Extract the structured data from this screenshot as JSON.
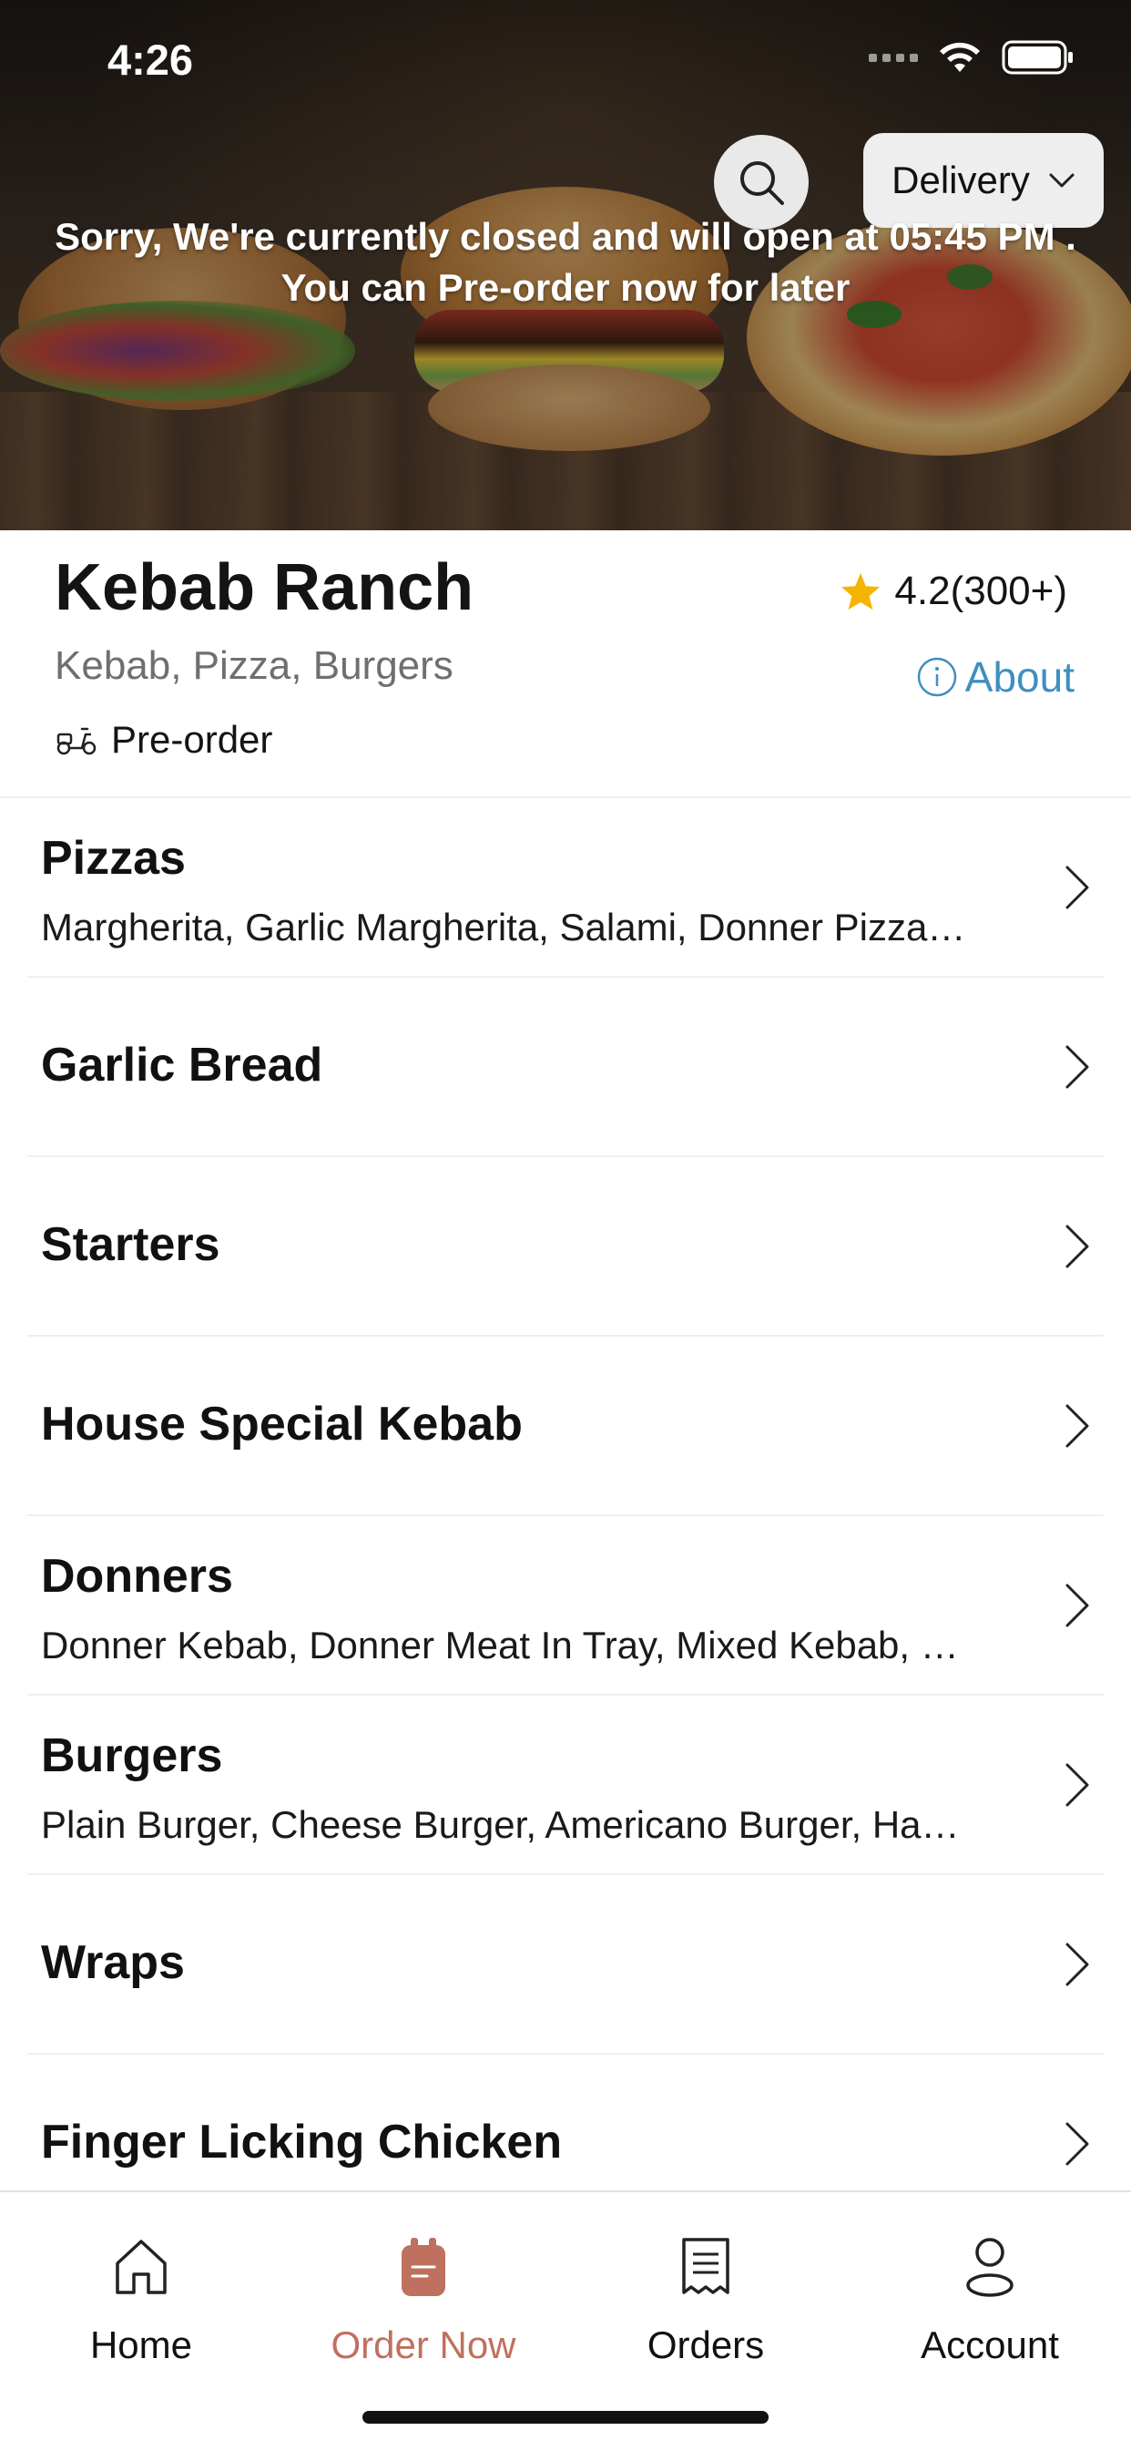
{
  "status_bar": {
    "time": "4:26"
  },
  "header": {
    "delivery_mode": "Delivery",
    "closed_message_line1": "Sorry, We're currently closed and will open at 05:45 PM .",
    "closed_message_line2": "You can Pre-order now for later"
  },
  "restaurant": {
    "name": "Kebab Ranch",
    "cuisines": "Kebab, Pizza, Burgers",
    "order_type": "Pre-order",
    "rating": "4.2(300+)",
    "about_label": "About"
  },
  "categories": [
    {
      "title": "Pizzas",
      "desc": "Margherita, Garlic Margherita, Salami, Donner Pizza,..."
    },
    {
      "title": "Garlic Bread",
      "desc": ""
    },
    {
      "title": "Starters",
      "desc": ""
    },
    {
      "title": "House Special Kebab",
      "desc": ""
    },
    {
      "title": "Donners",
      "desc": "Donner Kebab, Donner Meat In Tray, Mixed Kebab, Mi..."
    },
    {
      "title": "Burgers",
      "desc": "Plain Burger, Cheese Burger, Americano Burger, Hawa..."
    },
    {
      "title": "Wraps",
      "desc": ""
    },
    {
      "title": "Finger Licking Chicken",
      "desc": ""
    }
  ],
  "bottom_nav": {
    "home": "Home",
    "order_now": "Order Now",
    "orders": "Orders",
    "account": "Account",
    "active": "order_now"
  },
  "colors": {
    "accent": "#c0705e",
    "link": "#3f8fbf",
    "star": "#f5b400"
  }
}
